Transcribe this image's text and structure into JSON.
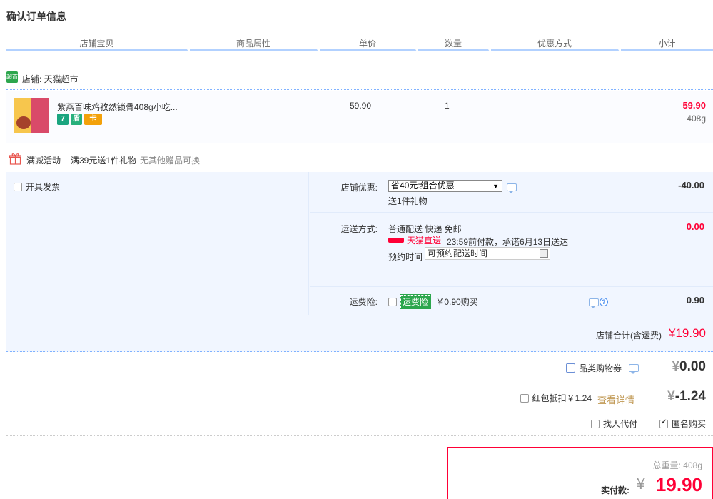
{
  "page": {
    "title": "确认订单信息"
  },
  "table_headers": [
    "店铺宝贝",
    "商品属性",
    "单价",
    "数量",
    "优惠方式",
    "小计"
  ],
  "shop": {
    "label": "店铺: 天猫超市",
    "icon_text": "超市"
  },
  "item": {
    "name": "紫燕百味鸡孜然锁骨408g小吃...",
    "price": "59.90",
    "quantity": "1",
    "subtotal": "59.90",
    "weight": "408g",
    "badges": [
      "7",
      "盾",
      "卡"
    ]
  },
  "promo": {
    "tag": "满减活动",
    "text": "满39元送1件礼物",
    "note": "无其他赠品可换"
  },
  "invoice": {
    "label": "开具发票",
    "checked": false
  },
  "shop_discount": {
    "label": "店铺优惠:",
    "selected": "省40元:组合优惠",
    "gift_line": "送1件礼物",
    "amount": "-40.00"
  },
  "shipping": {
    "label": "运送方式:",
    "method": "普通配送 快递 免邮",
    "tmall_direct": "天猫直送",
    "promise": "23:59前付款，承诺6月13日送达",
    "reserve_label": "预约时间",
    "reserve_placeholder": "可预约配送时间",
    "amount": "0.00"
  },
  "insurance": {
    "label": "运费险:",
    "tag": "运费险",
    "price_text": "￥0.90购买",
    "amount": "0.90",
    "checked": false
  },
  "shop_total": {
    "label": "店铺合计(含运费)",
    "amount": "¥19.90"
  },
  "coupon": {
    "label": "品类购物券",
    "currency": "¥",
    "amount": "0.00",
    "checked": false
  },
  "red_envelope": {
    "label": "红包抵扣￥1.24",
    "link": "查看详情",
    "currency": "¥",
    "amount": "-1.24",
    "checked": false
  },
  "extras": {
    "proxy_pay": {
      "label": "找人代付",
      "checked": false
    },
    "anonymous": {
      "label": "匿名购买",
      "checked": true
    }
  },
  "summary": {
    "weight_text": "总重量: 408g",
    "pay_label": "实付款:",
    "currency": "¥",
    "pay_amount": "19.90"
  },
  "colors": {
    "accent_red": "#ff0036",
    "panel_blue": "#f1f6ff",
    "header_line": "#b2d1ff",
    "green": "#2ca64d"
  }
}
